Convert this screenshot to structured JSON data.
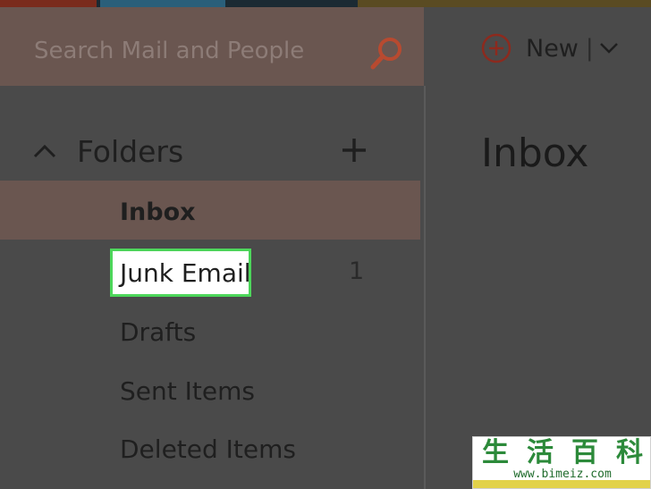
{
  "search": {
    "placeholder": "Search Mail and People",
    "icon": "search-icon"
  },
  "toolbar": {
    "new_label": "New",
    "separator": "|",
    "plus_icon": "plus-circle-icon",
    "dropdown_icon": "chevron-down-icon"
  },
  "folders": {
    "title": "Folders",
    "collapse_icon": "chevron-up-icon",
    "add_icon": "plus-icon",
    "items": [
      {
        "label": "Inbox",
        "count": "",
        "selected": true
      },
      {
        "label": "Junk Email",
        "count": "1",
        "highlighted": true
      },
      {
        "label": "Drafts",
        "count": ""
      },
      {
        "label": "Sent Items",
        "count": ""
      },
      {
        "label": "Deleted Items",
        "count": ""
      }
    ]
  },
  "main": {
    "title": "Inbox"
  },
  "watermark": {
    "chars": [
      "生",
      "活",
      "百",
      "科"
    ],
    "url": "www.bimeiz.com"
  },
  "colors": {
    "accent": "#c0392b",
    "highlight_border": "#4cd65a",
    "selected_row": "#6a5650"
  }
}
